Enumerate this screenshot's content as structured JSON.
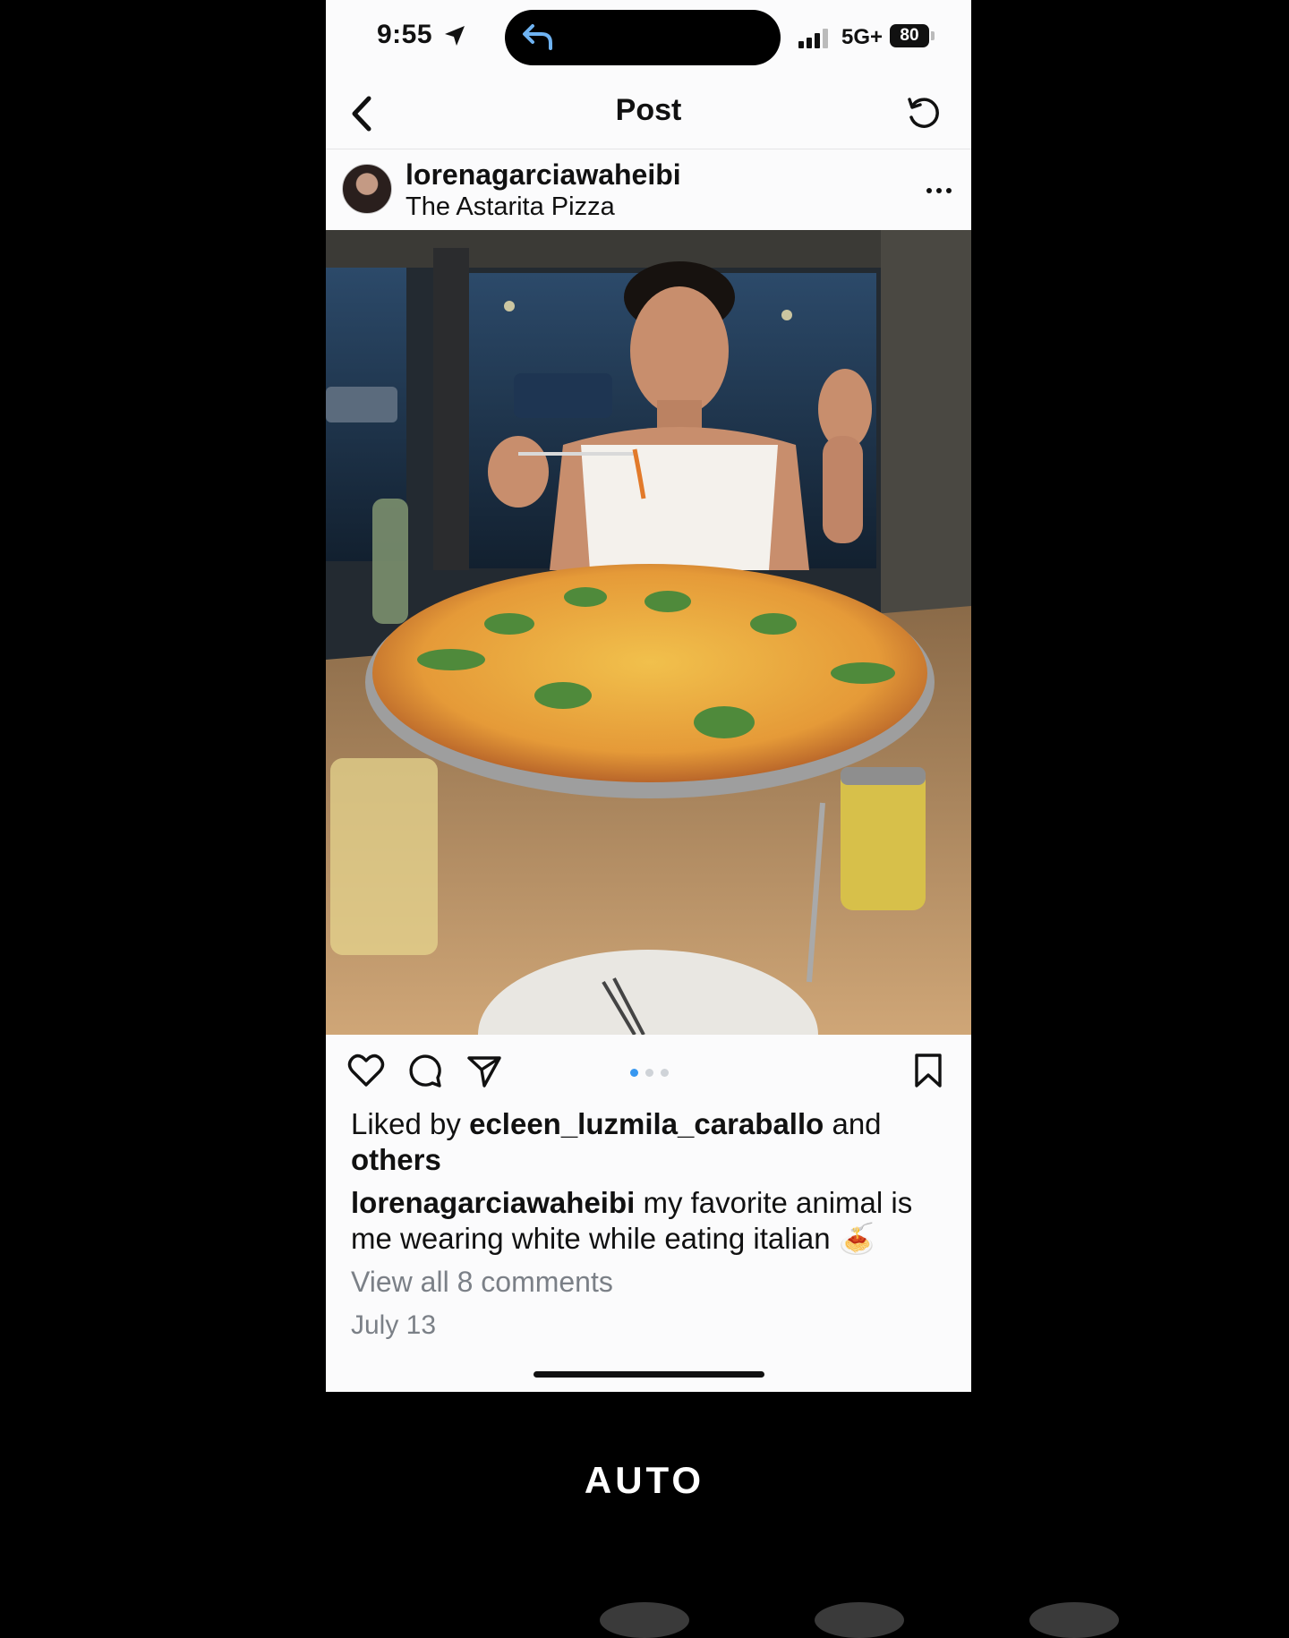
{
  "status_bar": {
    "time": "9:55",
    "network": "5G+",
    "battery": "80"
  },
  "header": {
    "title": "Post"
  },
  "post": {
    "username": "lorenagarciawaheibi",
    "location": "The Astarita Pizza",
    "liked_prefix": "Liked by ",
    "liked_user": "ecleen_luzmila_caraballo",
    "liked_and": " and",
    "liked_others": "others",
    "caption_user": "lorenagarciawaheibi",
    "caption_text": " my favorite animal is me wearing white while eating italian 🍝",
    "view_comments": "View all 8 comments",
    "date": "July 13"
  },
  "carousel": {
    "count": 3,
    "active": 1
  },
  "overlay": {
    "label": "AUTO"
  },
  "colors": {
    "accent": "#3797f0",
    "secondary_text": "#7b8087"
  }
}
